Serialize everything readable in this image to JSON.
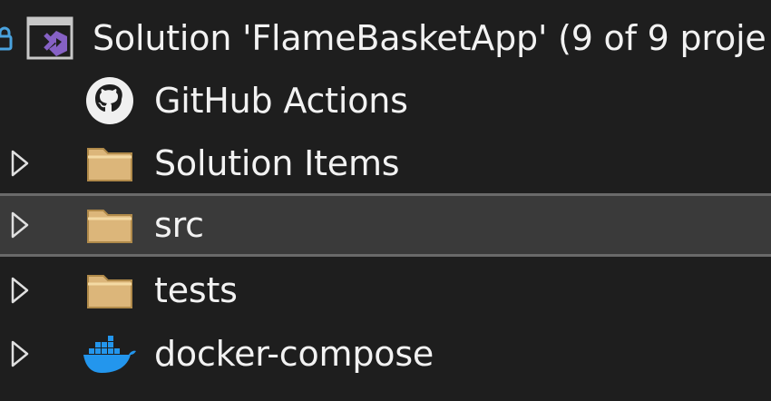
{
  "solution": {
    "label": "Solution 'FlameBasketApp' (9 of 9 proje",
    "icon": "visual-studio-solution-icon"
  },
  "items": [
    {
      "label": "GitHub Actions",
      "icon": "github-icon",
      "expandable": false,
      "selected": false
    },
    {
      "label": "Solution Items",
      "icon": "folder-icon",
      "expandable": true,
      "selected": false
    },
    {
      "label": "src",
      "icon": "folder-icon",
      "expandable": true,
      "selected": true
    },
    {
      "label": "tests",
      "icon": "folder-icon",
      "expandable": true,
      "selected": false
    },
    {
      "label": "docker-compose",
      "icon": "docker-icon",
      "expandable": true,
      "selected": false
    }
  ],
  "colors": {
    "background": "#1e1e1e",
    "selected_row": "#3a3a3a",
    "folder": "#dcb67a",
    "vs_purple": "#8661c5",
    "docker_blue": "#2396ed",
    "text": "#f2f2f2"
  }
}
